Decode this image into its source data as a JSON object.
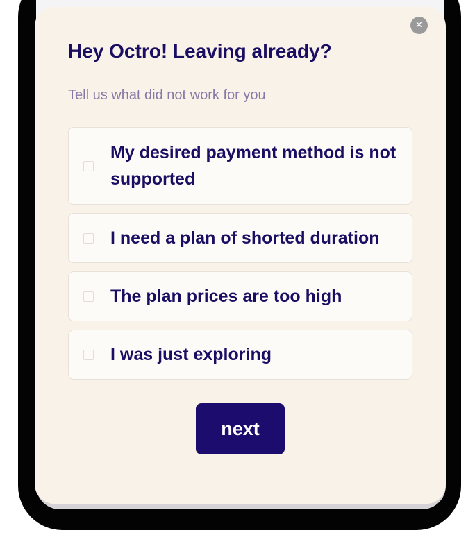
{
  "modal": {
    "title": "Hey Octro! Leaving already?",
    "subtitle": "Tell us what did not work for you",
    "close_icon": "close-icon",
    "close_glyph": "✕",
    "options": [
      {
        "label": "My desired payment method is not supported",
        "checked": false
      },
      {
        "label": "I need a plan of shorted duration",
        "checked": false
      },
      {
        "label": "The plan prices are too high",
        "checked": false
      },
      {
        "label": "I was just exploring",
        "checked": false
      }
    ],
    "next_label": "next"
  },
  "colors": {
    "modal_bg": "#f9f2e8",
    "title": "#1a0e63",
    "subtitle": "#857aa6",
    "button_bg": "#1b0c6e",
    "device_frame": "#030303"
  }
}
